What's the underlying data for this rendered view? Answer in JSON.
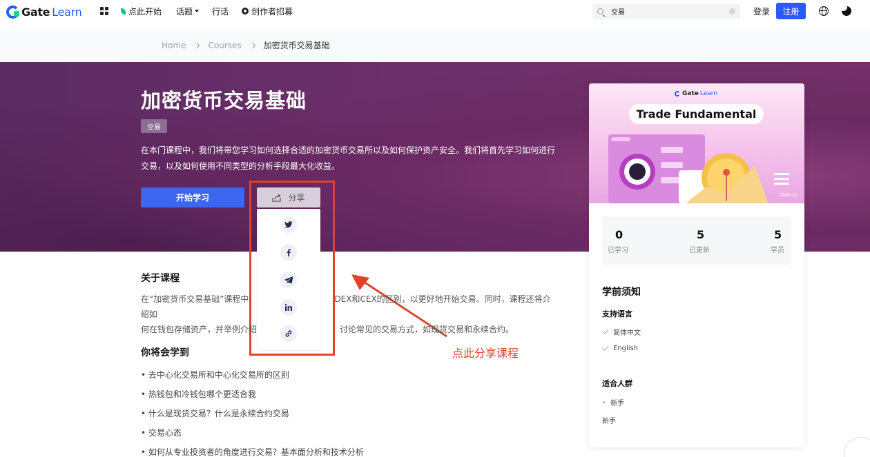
{
  "nav": {
    "logo_main": "Gate",
    "logo_sub": "Learn",
    "start_here": "点此开始",
    "topics": "话题",
    "glossary": "行话",
    "creator_recruit": "创作者招募",
    "search_value": "交易",
    "login": "登录",
    "register": "注册"
  },
  "breadcrumb": {
    "home": "Home",
    "courses": "Courses",
    "current": "加密货币交易基础"
  },
  "hero": {
    "title": "加密货币交易基础",
    "tag": "交易",
    "description": "在本门课程中，我们将带您学习如何选择合适的加密货币交易所以及如何保护资产安全。我们将首先学习如何进行交易，以及如何使用不同类型的分析手段最大化收益。",
    "start_button": "开始学习",
    "share_button": "分享"
  },
  "share_menu": [
    "twitter-icon",
    "facebook-icon",
    "telegram-icon",
    "linkedin-icon",
    "link-icon"
  ],
  "annotation": {
    "text": "点此分享课程",
    "color": "#e0432c"
  },
  "about": {
    "title": "关于课程",
    "text_a": "在“加密货币交易基础”课程中",
    "text_b": "DEX和CEX的区别，以更好地开始交易。同时，课程还将介绍如",
    "text_c": "何在钱包存储资产，并举例介绍",
    "text_d": "讨论常见的交易方式，如现货交易和永续合约。"
  },
  "learn": {
    "title": "你将会学到",
    "items": [
      "去中心化交易所和中心化交易所的区别",
      "热钱包和冷钱包哪个更适合我",
      "什么是现货交易？什么是永续合约交易",
      "交易心态",
      "如何从专业投资者的角度进行交易？基本面分析和技术分析"
    ]
  },
  "card": {
    "cover_logo_main": "Gate",
    "cover_logo_sub": "Learn",
    "cover_title": "Trade Fundamental",
    "cover_brand": "Gate.io",
    "stats": [
      {
        "value": "0",
        "label": "已学习"
      },
      {
        "value": "5",
        "label": "已更新"
      },
      {
        "value": "5",
        "label": "学员"
      }
    ],
    "prereq_title": "学前须知",
    "lang_title": "支持语言",
    "languages": [
      "简体中文",
      "English"
    ],
    "audience_title": "适合人群",
    "audience": [
      "新手",
      "新手"
    ]
  },
  "colors": {
    "brand_blue": "#2a5bf6",
    "hero_purple": "#6b2f6b",
    "annotation_red": "#e0432c"
  }
}
